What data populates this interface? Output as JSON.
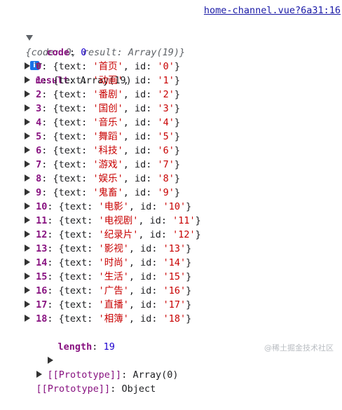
{
  "source_link": "home-channel.vue?6a31:16",
  "root_preview": {
    "open_brace": "{",
    "code_key": "code",
    "code_value": "0",
    "result_key": "result",
    "result_value": "Array(19)",
    "close_brace": "}",
    "info_icon_label": "i"
  },
  "code": {
    "key": "code",
    "value": "0"
  },
  "result": {
    "key": "result",
    "type_label": "Array(19)",
    "items": [
      {
        "index": "0",
        "text": "首页",
        "id": "0"
      },
      {
        "index": "1",
        "text": "动画",
        "id": "1"
      },
      {
        "index": "2",
        "text": "番剧",
        "id": "2"
      },
      {
        "index": "3",
        "text": "国创",
        "id": "3"
      },
      {
        "index": "4",
        "text": "音乐",
        "id": "4"
      },
      {
        "index": "5",
        "text": "舞蹈",
        "id": "5"
      },
      {
        "index": "6",
        "text": "科技",
        "id": "6"
      },
      {
        "index": "7",
        "text": "游戏",
        "id": "7"
      },
      {
        "index": "8",
        "text": "娱乐",
        "id": "8"
      },
      {
        "index": "9",
        "text": "鬼畜",
        "id": "9"
      },
      {
        "index": "10",
        "text": "电影",
        "id": "10"
      },
      {
        "index": "11",
        "text": "电视剧",
        "id": "11"
      },
      {
        "index": "12",
        "text": "纪录片",
        "id": "12"
      },
      {
        "index": "13",
        "text": "影视",
        "id": "13"
      },
      {
        "index": "14",
        "text": "时尚",
        "id": "14"
      },
      {
        "index": "15",
        "text": "生活",
        "id": "15"
      },
      {
        "index": "16",
        "text": "广告",
        "id": "16"
      },
      {
        "index": "17",
        "text": "直播",
        "id": "17"
      },
      {
        "index": "18",
        "text": "相簿",
        "id": "18"
      }
    ],
    "length_key": "length",
    "length_value": "19",
    "array_proto_key": "[[Prototype]]",
    "array_proto_value": "Array(0)"
  },
  "object_proto": {
    "key": "[[Prototype]]",
    "value": "Object"
  },
  "watermark": "@稀土掘金技术社区"
}
